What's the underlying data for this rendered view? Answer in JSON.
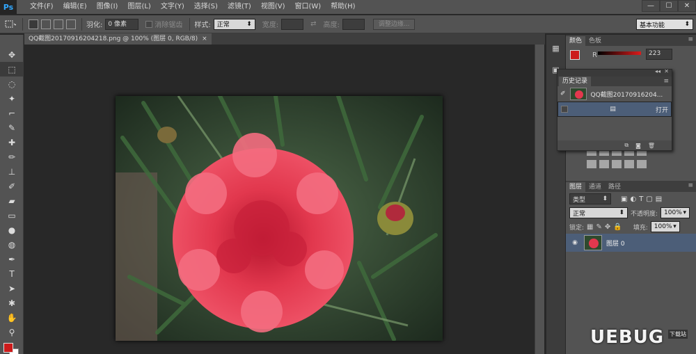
{
  "app": {
    "logo": "Ps",
    "workspace": "基本功能"
  },
  "menu": [
    "文件(F)",
    "编辑(E)",
    "图像(I)",
    "图层(L)",
    "文字(Y)",
    "选择(S)",
    "滤镜(T)",
    "视图(V)",
    "窗口(W)",
    "帮助(H)"
  ],
  "window_buttons": {
    "minimize": "—",
    "maximize": "☐",
    "close": "✕"
  },
  "options": {
    "feather_label": "羽化:",
    "feather_value": "0 像素",
    "antialias_label": "消除锯齿",
    "style_label": "样式:",
    "style_value": "正常",
    "width_label": "宽度:",
    "height_label": "高度:",
    "refine_button": "调整边缘..."
  },
  "document": {
    "tab_title": "QQ截图20170916204218.png @ 100% (图层 0, RGB/8)",
    "close": "×"
  },
  "color_panel": {
    "tabs": [
      "颜色",
      "色板"
    ],
    "channel": "R",
    "value": "223",
    "fg_color": "#cc1b1b"
  },
  "history_panel": {
    "title": "历史记录",
    "snapshot": "QQ截图20170916204...",
    "step": "打开"
  },
  "layers_panel": {
    "tabs": [
      "图层",
      "通道",
      "路径"
    ],
    "filter": "类型",
    "blend_mode": "正常",
    "opacity_label": "不透明度:",
    "opacity_value": "100%",
    "lock_label": "锁定:",
    "fill_label": "填充:",
    "fill_value": "100%",
    "layer_name": "图层 0"
  },
  "watermark": {
    "text": "UEBUG",
    "sub": "下载站"
  }
}
